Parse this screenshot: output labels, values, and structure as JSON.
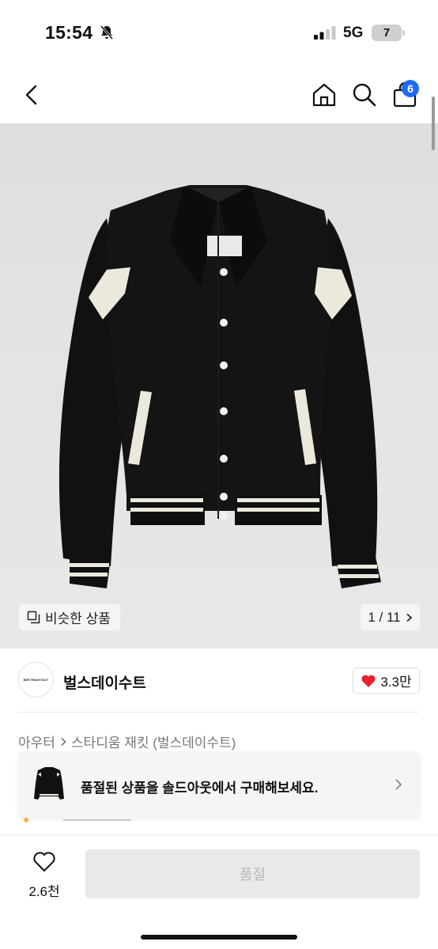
{
  "status_bar": {
    "time": "15:54",
    "network": "5G",
    "battery": "7"
  },
  "nav": {
    "cart_count": "6"
  },
  "gallery": {
    "similar_label": "비슷한 상품",
    "page_indicator": "1 / 11"
  },
  "shop": {
    "logo_text": "BIRTHDAYSUIT",
    "name": "벌스데이수트",
    "likes": "3.3만"
  },
  "breadcrumb": {
    "category": "아우터",
    "product": "스타디움 재킷 (벌스데이수트)"
  },
  "soldout_banner": {
    "text": "품절된 상품을 솔드아웃에서 구매해보세요."
  },
  "bottom": {
    "wish_count": "2.6천",
    "action_label": "품절"
  },
  "colors": {
    "badge": "#1e6cf5",
    "heart": "#e8202c",
    "disabled_button": "#e9e9e9"
  }
}
